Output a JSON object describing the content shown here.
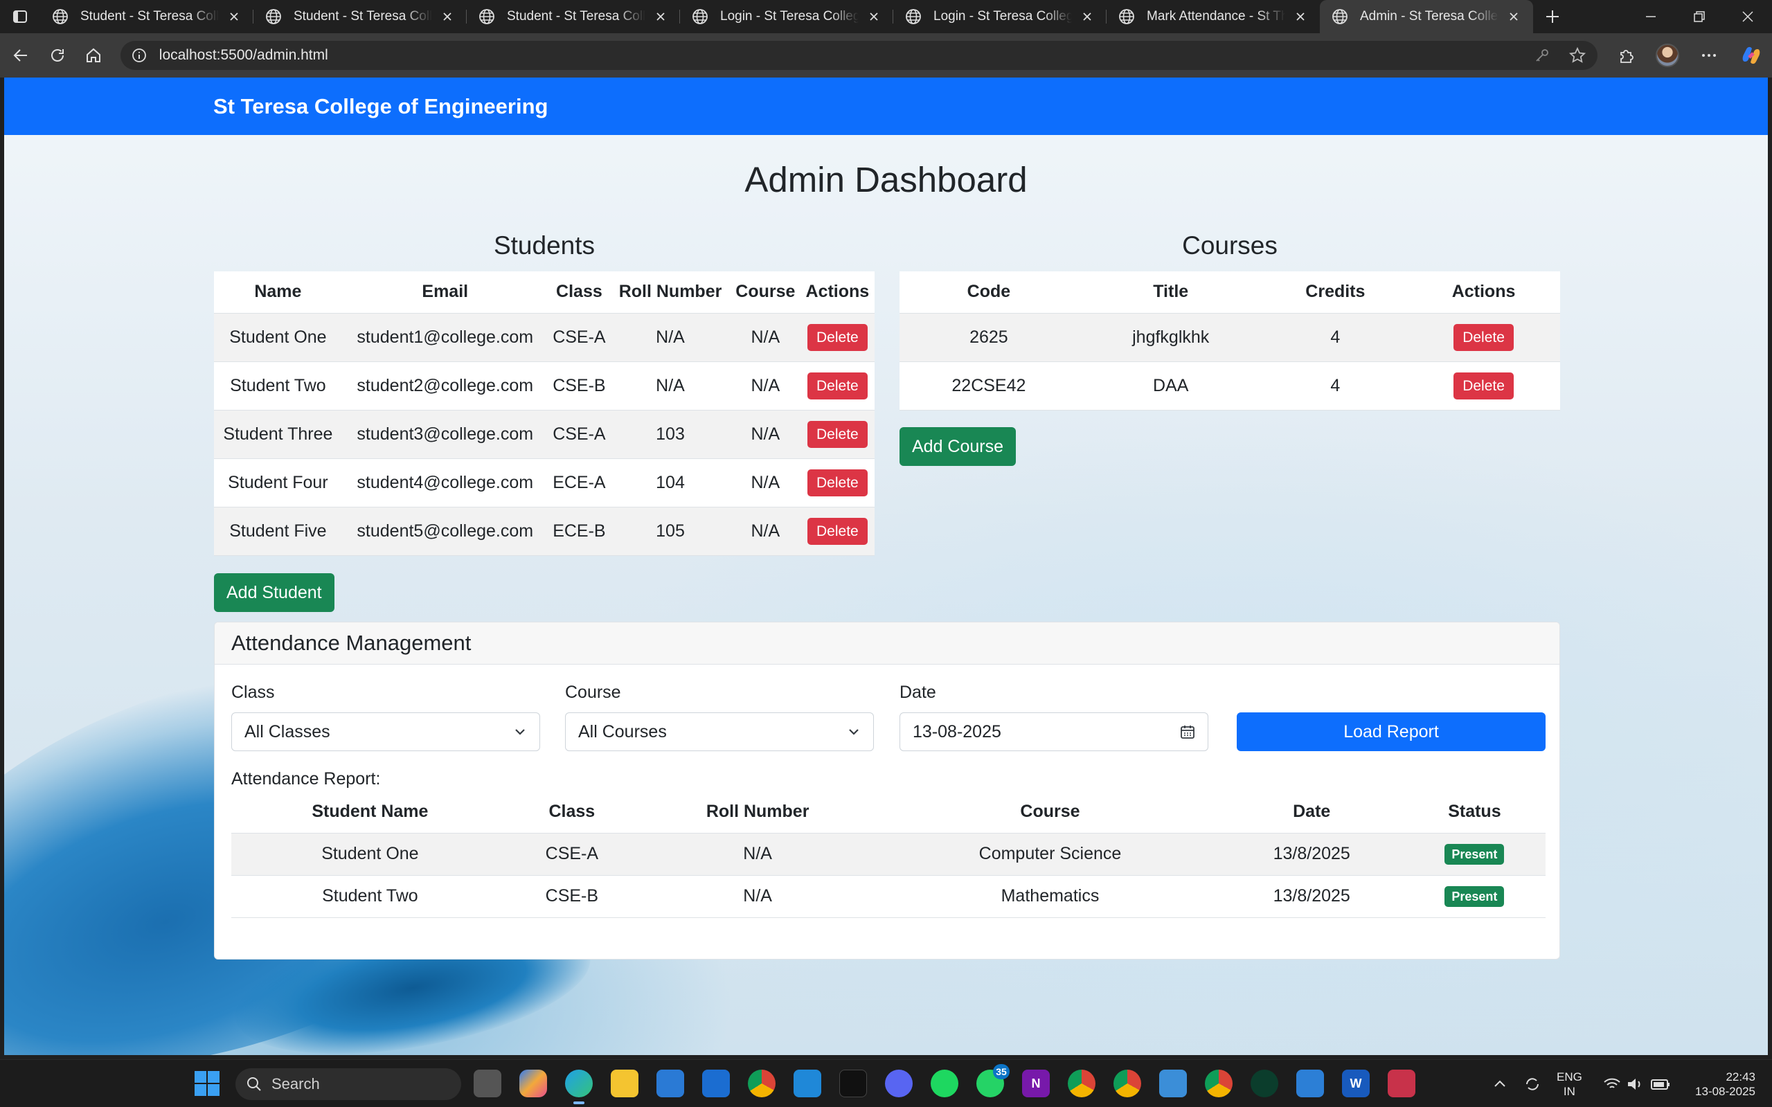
{
  "browser": {
    "tabs": [
      {
        "title": "Student - St Teresa College",
        "active": false
      },
      {
        "title": "Student - St Teresa College",
        "active": false
      },
      {
        "title": "Student - St Teresa College",
        "active": false
      },
      {
        "title": "Login - St Teresa College of",
        "active": false
      },
      {
        "title": "Login - St Teresa College of",
        "active": false
      },
      {
        "title": "Mark Attendance - St Theresa",
        "active": false
      },
      {
        "title": "Admin - St Teresa College of",
        "active": true
      }
    ],
    "url": "localhost:5500/admin.html"
  },
  "navbar": {
    "brand": "St Teresa College of Engineering"
  },
  "page": {
    "title": "Admin Dashboard"
  },
  "students": {
    "title": "Students",
    "columns": [
      "Name",
      "Email",
      "Class",
      "Roll Number",
      "Course",
      "Actions"
    ],
    "rows": [
      {
        "name": "Student One",
        "email": "student1@college.com",
        "class": "CSE-A",
        "roll": "N/A",
        "course": "N/A"
      },
      {
        "name": "Student Two",
        "email": "student2@college.com",
        "class": "CSE-B",
        "roll": "N/A",
        "course": "N/A"
      },
      {
        "name": "Student Three",
        "email": "student3@college.com",
        "class": "CSE-A",
        "roll": "103",
        "course": "N/A"
      },
      {
        "name": "Student Four",
        "email": "student4@college.com",
        "class": "ECE-A",
        "roll": "104",
        "course": "N/A"
      },
      {
        "name": "Student Five",
        "email": "student5@college.com",
        "class": "ECE-B",
        "roll": "105",
        "course": "N/A"
      }
    ],
    "delete_label": "Delete",
    "add_label": "Add Student"
  },
  "courses": {
    "title": "Courses",
    "columns": [
      "Code",
      "Title",
      "Credits",
      "Actions"
    ],
    "rows": [
      {
        "code": "2625",
        "title": "jhgfkglkhk",
        "credits": "4"
      },
      {
        "code": "22CSE42",
        "title": "DAA",
        "credits": "4"
      }
    ],
    "delete_label": "Delete",
    "add_label": "Add Course"
  },
  "attendance": {
    "title": "Attendance Management",
    "class_label": "Class",
    "class_value": "All Classes",
    "course_label": "Course",
    "course_value": "All Courses",
    "date_label": "Date",
    "date_value": "13-08-2025",
    "load_label": "Load Report",
    "report_label": "Attendance Report:",
    "columns": [
      "Student Name",
      "Class",
      "Roll Number",
      "Course",
      "Date",
      "Status"
    ],
    "rows": [
      {
        "name": "Student One",
        "class": "CSE-A",
        "roll": "N/A",
        "course": "Computer Science",
        "date": "13/8/2025",
        "status": "Present"
      },
      {
        "name": "Student Two",
        "class": "CSE-B",
        "roll": "N/A",
        "course": "Mathematics",
        "date": "13/8/2025",
        "status": "Present"
      }
    ]
  },
  "taskbar": {
    "search_placeholder": "Search",
    "whatsapp_badge": "35",
    "lang_line1": "ENG",
    "lang_line2": "IN",
    "time": "22:43",
    "date": "13-08-2025"
  },
  "colors": {
    "primary": "#0d6efd",
    "danger": "#dc3545",
    "success": "#198754"
  }
}
